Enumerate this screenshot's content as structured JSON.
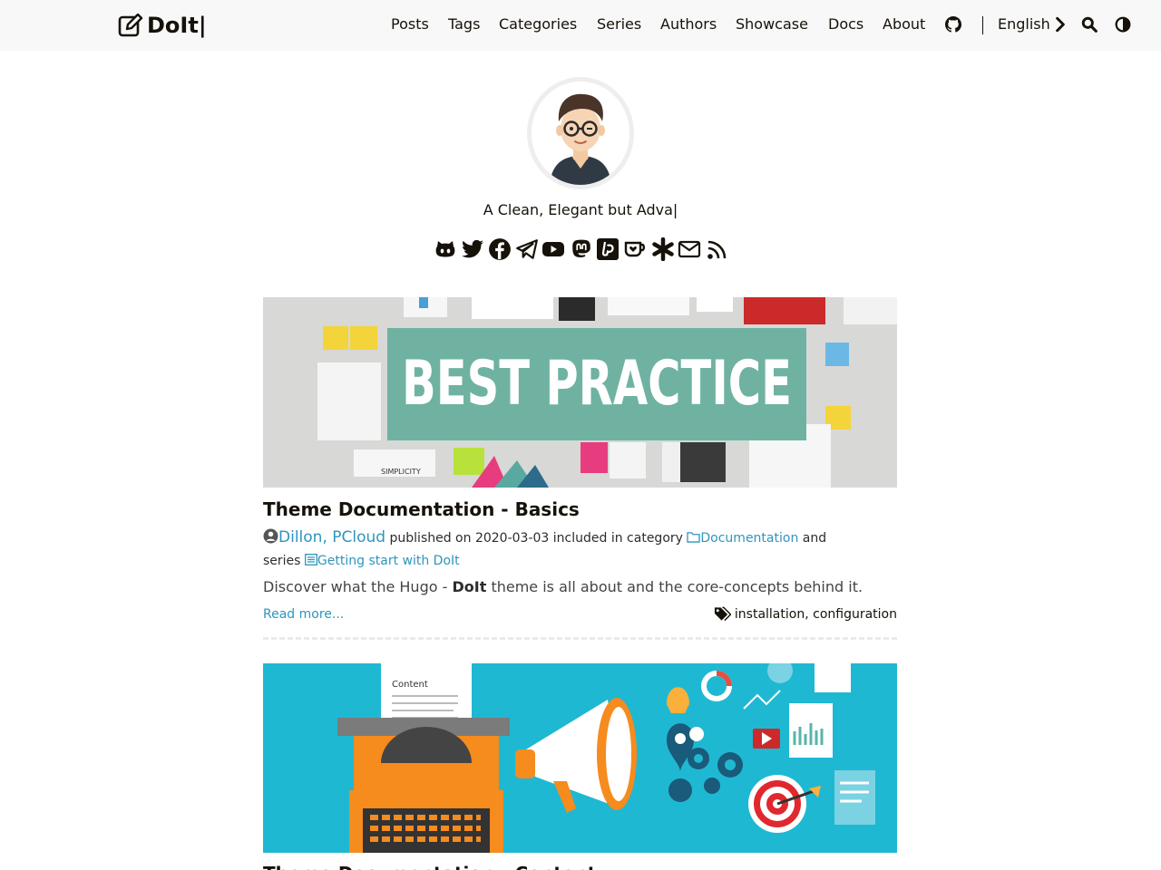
{
  "header": {
    "logo_text": "DoIt|",
    "nav": [
      "Posts",
      "Tags",
      "Categories",
      "Series",
      "Authors",
      "Showcase",
      "Docs",
      "About"
    ],
    "language": "English"
  },
  "profile": {
    "subtitle": "A Clean, Elegant but Adva|"
  },
  "posts": [
    {
      "cover_text": "BEST PRACTICE",
      "title": "Theme Documentation - Basics",
      "author1": "Dillon",
      "author2": "PCloud",
      "published_label": "published on",
      "date": "2020-03-03",
      "category_label": "included in category",
      "category": "Documentation",
      "and_label": "and",
      "series_label": "series",
      "series": "Getting start with DoIt",
      "summary_pre": "Discover what the Hugo -",
      "summary_bold": "DoIt",
      "summary_post": "theme is all about and the core-concepts behind it.",
      "read_more": "Read more...",
      "tags": [
        "installation",
        "configuration"
      ]
    },
    {
      "cover_text": "Content",
      "title": "Theme Documentation - Content"
    }
  ],
  "colors": {
    "link": "#2d96bd",
    "text": "#161209",
    "header_bg": "#f8f8f8"
  }
}
